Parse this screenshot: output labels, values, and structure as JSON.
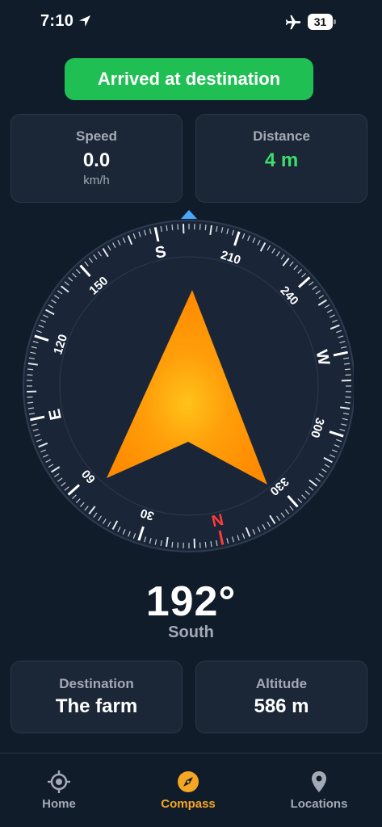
{
  "status_bar": {
    "time": "7:10",
    "battery": "31",
    "location_icon": "location-arrow-icon",
    "airplane_icon": "airplane-icon"
  },
  "banner": {
    "text": "Arrived at destination",
    "color": "#1fbf54"
  },
  "speed": {
    "label": "Speed",
    "value": "0.0",
    "unit": "km/h"
  },
  "distance": {
    "label": "Distance",
    "value": "4 m",
    "value_color": "#3ddc6b"
  },
  "compass": {
    "heading_degrees": 192,
    "cardinals": [
      "N",
      "E",
      "S",
      "W"
    ],
    "degree_labels": [
      "30",
      "60",
      "120",
      "150",
      "210",
      "240",
      "300",
      "330"
    ],
    "north_color": "#ff3b3b",
    "arrow_color": "#ff9500",
    "marker_color": "#4aa8ff"
  },
  "heading": {
    "value": "192°",
    "direction": "South"
  },
  "destination": {
    "label": "Destination",
    "value": "The farm"
  },
  "altitude": {
    "label": "Altitude",
    "value": "586 m"
  },
  "tabs": [
    {
      "label": "Home",
      "icon": "crosshair-icon",
      "active": false
    },
    {
      "label": "Compass",
      "icon": "compass-icon",
      "active": true
    },
    {
      "label": "Locations",
      "icon": "map-pin-icon",
      "active": false
    }
  ],
  "colors": {
    "background": "#111c2b",
    "card": "#1b2636",
    "accent": "#f5a623"
  }
}
